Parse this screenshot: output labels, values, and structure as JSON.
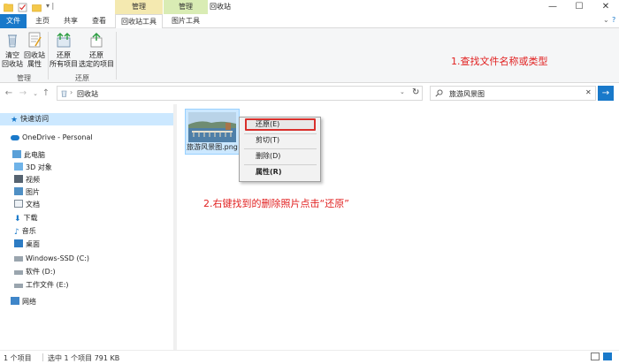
{
  "titlebar": {
    "context_manage_1": "管理",
    "context_manage_2": "管理",
    "window_title": "回收站",
    "minimize": "—",
    "maximize": "☐",
    "close": "✕"
  },
  "tabs": {
    "file": "文件",
    "home": "主页",
    "share": "共享",
    "view": "查看",
    "recycle_tools": "回收站工具",
    "picture_tools": "图片工具"
  },
  "ribbon": {
    "empty_line1": "清空",
    "empty_line2": "回收站",
    "props_line1": "回收站",
    "props_line2": "属性",
    "restore_all_line1": "还原",
    "restore_all_line2": "所有项目",
    "restore_sel_line1": "还原",
    "restore_sel_line2": "选定的项目",
    "group_manage": "管理",
    "group_restore": "还原"
  },
  "address": {
    "path": "回收站",
    "search_value": "旅游风景图"
  },
  "navpane": {
    "quick_access": "快速访问",
    "onedrive": "OneDrive - Personal",
    "this_pc": "此电脑",
    "objects3d": "3D 对象",
    "videos": "视频",
    "pictures": "图片",
    "documents": "文档",
    "downloads": "下载",
    "music": "音乐",
    "desktop": "桌面",
    "drive_c": "Windows-SSD (C:)",
    "drive_d": "软件 (D:)",
    "drive_e": "工作文件 (E:)",
    "network": "网络"
  },
  "file": {
    "name": "旅游风景图.png"
  },
  "context_menu": {
    "restore": "还原(E)",
    "cut": "剪切(T)",
    "delete": "删除(D)",
    "properties": "属性(R)"
  },
  "annotations": {
    "step1": "1.查找文件名称或类型",
    "step2": "2.右键找到的删除照片点击“还原”"
  },
  "status": {
    "count": "1 个项目",
    "selected": "选中 1 个项目  791 KB"
  },
  "colors": {
    "accent": "#1979ca",
    "annotation": "#e11f1f",
    "selection": "#cce8ff"
  }
}
